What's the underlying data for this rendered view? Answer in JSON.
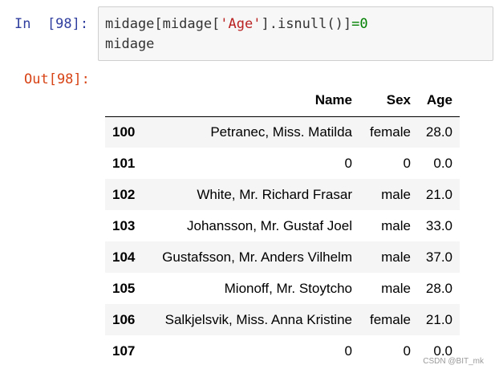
{
  "input_cell": {
    "prompt": "In  [98]:",
    "code": {
      "line1": {
        "part1": "midage[midage[",
        "string": "'Age'",
        "part2": "].isnull()]",
        "op": "=",
        "num": "0"
      },
      "line2": "midage"
    }
  },
  "output_cell": {
    "prompt": "Out[98]:"
  },
  "dataframe": {
    "columns": [
      "",
      "Name",
      "Sex",
      "Age"
    ],
    "rows": [
      {
        "index": "100",
        "name": "Petranec, Miss. Matilda",
        "sex": "female",
        "age": "28.0"
      },
      {
        "index": "101",
        "name": "0",
        "sex": "0",
        "age": "0.0"
      },
      {
        "index": "102",
        "name": "White, Mr. Richard Frasar",
        "sex": "male",
        "age": "21.0"
      },
      {
        "index": "103",
        "name": "Johansson, Mr. Gustaf Joel",
        "sex": "male",
        "age": "33.0"
      },
      {
        "index": "104",
        "name": "Gustafsson, Mr. Anders Vilhelm",
        "sex": "male",
        "age": "37.0"
      },
      {
        "index": "105",
        "name": "Mionoff, Mr. Stoytcho",
        "sex": "male",
        "age": "28.0"
      },
      {
        "index": "106",
        "name": "Salkjelsvik, Miss. Anna Kristine",
        "sex": "female",
        "age": "21.0"
      },
      {
        "index": "107",
        "name": "0",
        "sex": "0",
        "age": "0.0"
      }
    ]
  },
  "watermark": "CSDN @BIT_mk",
  "colors": {
    "in_prompt": "#303f9f",
    "out_prompt": "#d84315",
    "string": "#ba2121",
    "operator": "#008000",
    "cell_bg": "#f7f7f7",
    "row_stripe": "#f5f5f5"
  }
}
